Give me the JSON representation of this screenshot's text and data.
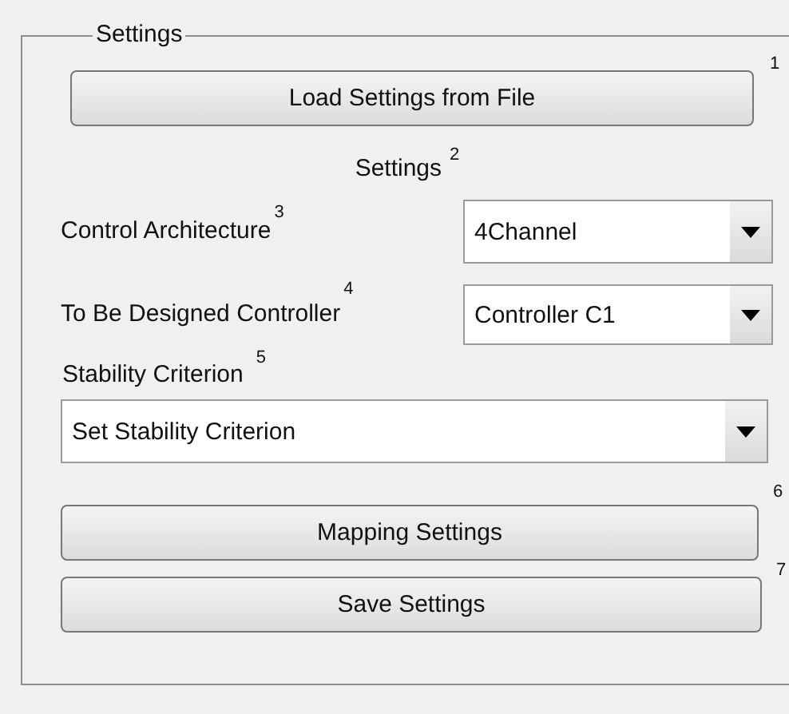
{
  "panel": {
    "title": "Settings"
  },
  "load_button": {
    "label": "Load Settings from File",
    "marker": "1"
  },
  "heading": {
    "text": "Settings",
    "marker": "2"
  },
  "control_architecture": {
    "label": "Control Architecture",
    "marker": "3",
    "value": "4Channel"
  },
  "controller": {
    "label": "To Be Designed Controller",
    "marker": "4",
    "value": "Controller C1"
  },
  "stability": {
    "label": "Stability Criterion",
    "marker": "5",
    "value": "Set Stability Criterion"
  },
  "mapping_button": {
    "label": "Mapping Settings",
    "marker": "6"
  },
  "save_button": {
    "label": "Save Settings",
    "marker": "7"
  }
}
